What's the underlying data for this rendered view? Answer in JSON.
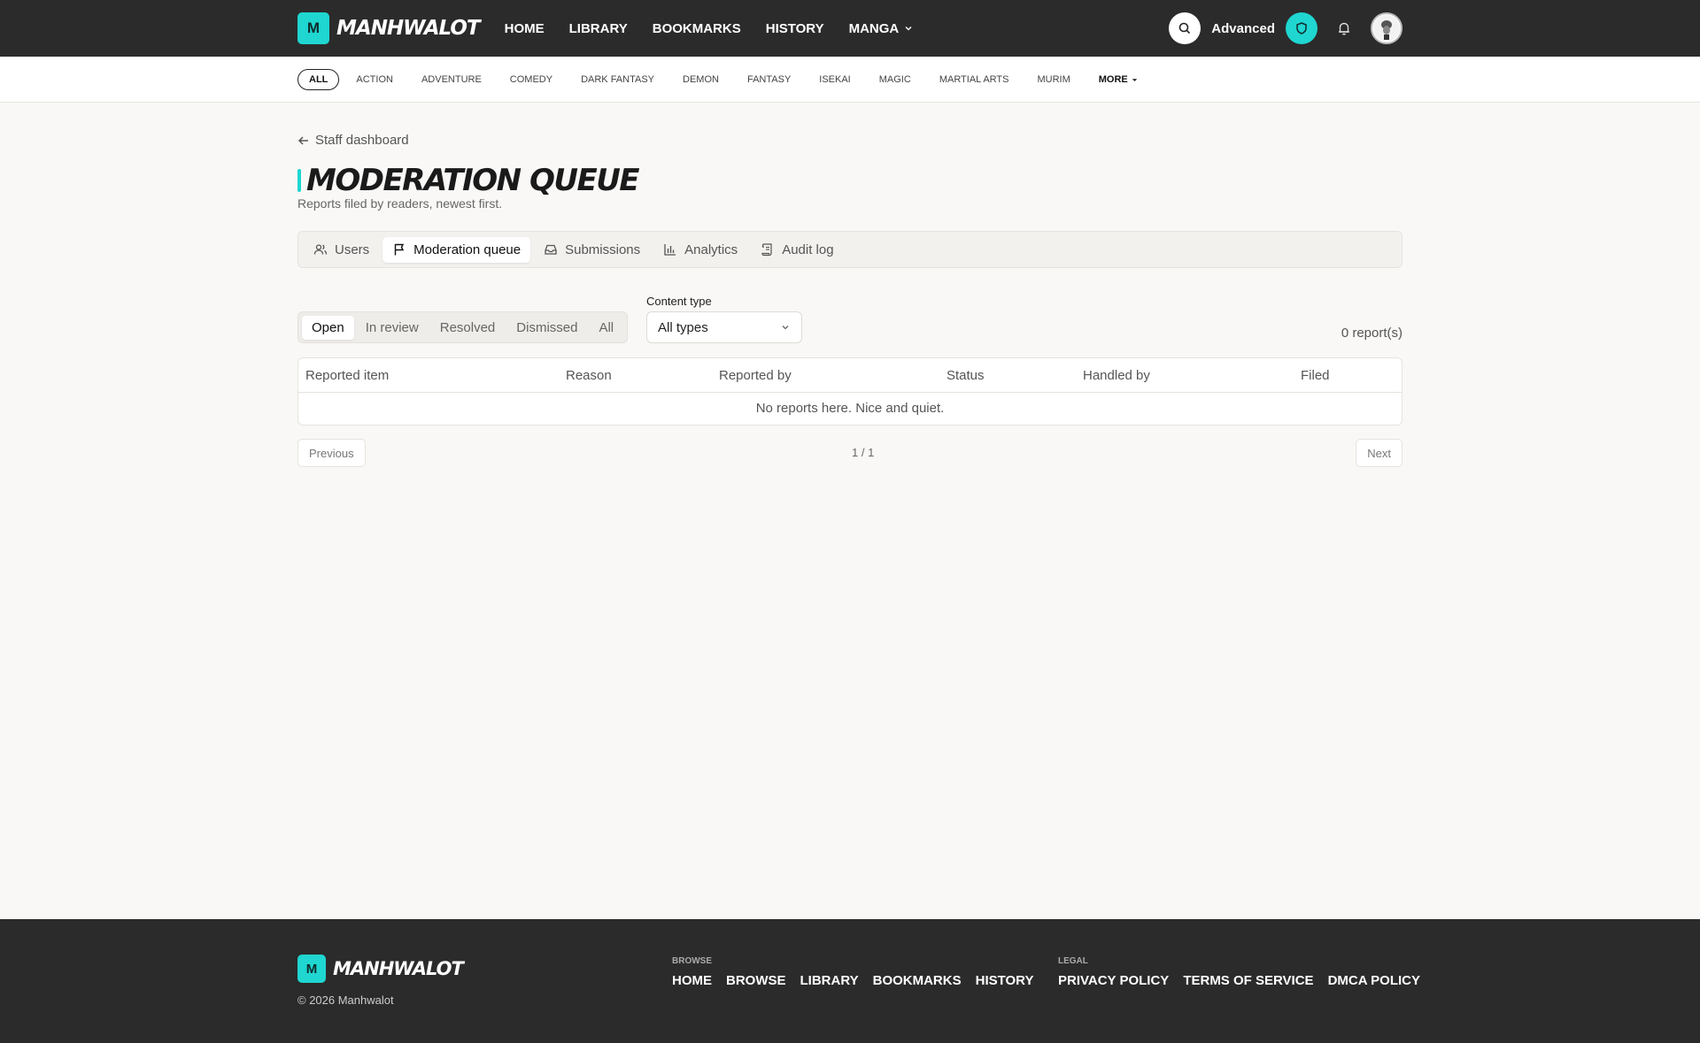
{
  "brand": {
    "logo_letter": "M",
    "name": "MANHWALOT"
  },
  "nav": {
    "items": [
      "HOME",
      "LIBRARY",
      "BOOKMARKS",
      "HISTORY"
    ],
    "manga_label": "MANGA",
    "advanced_label": "Advanced"
  },
  "genres": {
    "items": [
      "ALL",
      "ACTION",
      "ADVENTURE",
      "COMEDY",
      "DARK FANTASY",
      "DEMON",
      "FANTASY",
      "ISEKAI",
      "MAGIC",
      "MARTIAL ARTS",
      "MURIM"
    ],
    "active": "ALL",
    "more_label": "MORE"
  },
  "page": {
    "back_label": "Staff dashboard",
    "title": "MODERATION QUEUE",
    "subtitle": "Reports filed by readers, newest first."
  },
  "tabs": [
    {
      "label": "Users",
      "icon": "users-icon"
    },
    {
      "label": "Moderation queue",
      "icon": "flag-icon",
      "active": true
    },
    {
      "label": "Submissions",
      "icon": "inbox-icon"
    },
    {
      "label": "Analytics",
      "icon": "bar-chart-icon"
    },
    {
      "label": "Audit log",
      "icon": "scroll-icon"
    }
  ],
  "filters": {
    "status_options": [
      "Open",
      "In review",
      "Resolved",
      "Dismissed",
      "All"
    ],
    "active_status": "Open",
    "content_type_label": "Content type",
    "content_type_value": "All types",
    "count": "0 report(s)"
  },
  "table": {
    "headers": [
      "Reported item",
      "Reason",
      "Reported by",
      "Status",
      "Handled by",
      "Filed"
    ],
    "empty": "No reports here. Nice and quiet."
  },
  "pager": {
    "prev": "Previous",
    "info": "1 / 1",
    "next": "Next"
  },
  "footer": {
    "copyright": "© 2026 Manhwalot",
    "browse_head": "BROWSE",
    "browse_links": [
      "HOME",
      "BROWSE",
      "LIBRARY",
      "BOOKMARKS",
      "HISTORY"
    ],
    "legal_head": "LEGAL",
    "legal_links": [
      "PRIVACY POLICY",
      "TERMS OF SERVICE",
      "DMCA POLICY"
    ]
  },
  "colors": {
    "accent": "#1fd6d0",
    "dark": "#2b2b2b",
    "background": "#f9f8f6"
  }
}
